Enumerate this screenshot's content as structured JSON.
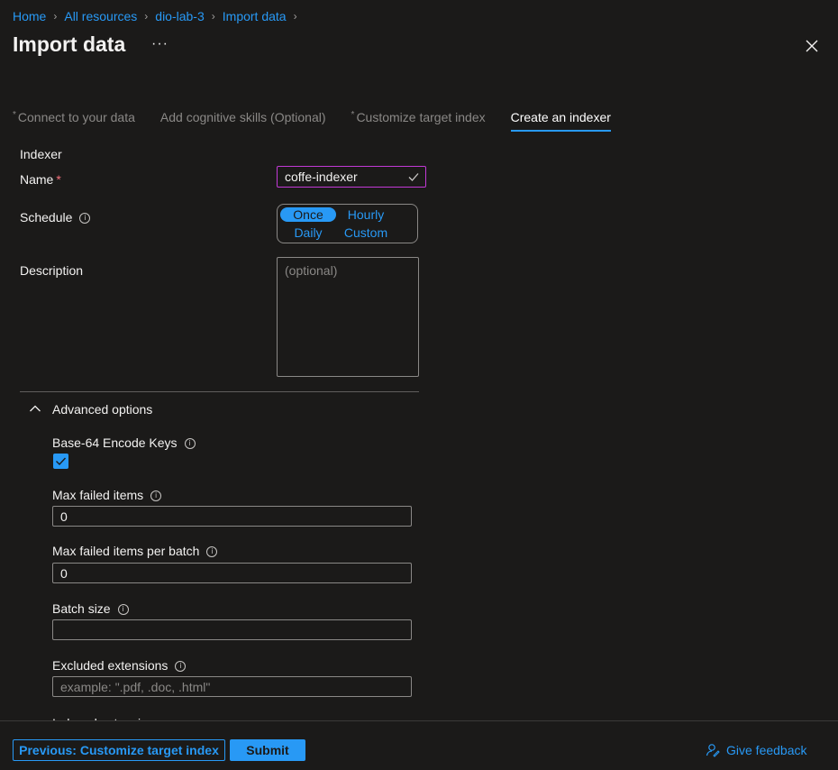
{
  "breadcrumb": [
    "Home",
    "All resources",
    "dio-lab-3",
    "Import data"
  ],
  "page_title": "Import data",
  "more_label": "···",
  "tabs": [
    {
      "label": "Connect to your data",
      "required": true
    },
    {
      "label": "Add cognitive skills (Optional)",
      "required": false
    },
    {
      "label": "Customize target index",
      "required": true
    },
    {
      "label": "Create an indexer",
      "required": false,
      "active": true
    }
  ],
  "form": {
    "section_label": "Indexer",
    "name_label": "Name",
    "required_marker": "*",
    "name_value": "coffe-indexer",
    "schedule_label": "Schedule",
    "schedule_options": [
      "Once",
      "Hourly",
      "Daily",
      "Custom"
    ],
    "schedule_selected": "Once",
    "description_label": "Description",
    "description_placeholder": "(optional)"
  },
  "advanced": {
    "title": "Advanced options",
    "base64_label": "Base-64 Encode Keys",
    "base64_checked": true,
    "max_failed_label": "Max failed items",
    "max_failed_value": "0",
    "max_failed_batch_label": "Max failed items per batch",
    "max_failed_batch_value": "0",
    "batch_size_label": "Batch size",
    "batch_size_value": "",
    "excluded_label": "Excluded extensions",
    "excluded_placeholder": "example: \".pdf, .doc, .html\"",
    "indexed_label": "Indexed extensions"
  },
  "footer": {
    "previous_label": "Previous: Customize target index",
    "submit_label": "Submit",
    "feedback_label": "Give feedback"
  },
  "colors": {
    "accent": "#2899f5",
    "background": "#1b1a19",
    "focus_border": "#c239d6",
    "required": "#f1707b"
  }
}
